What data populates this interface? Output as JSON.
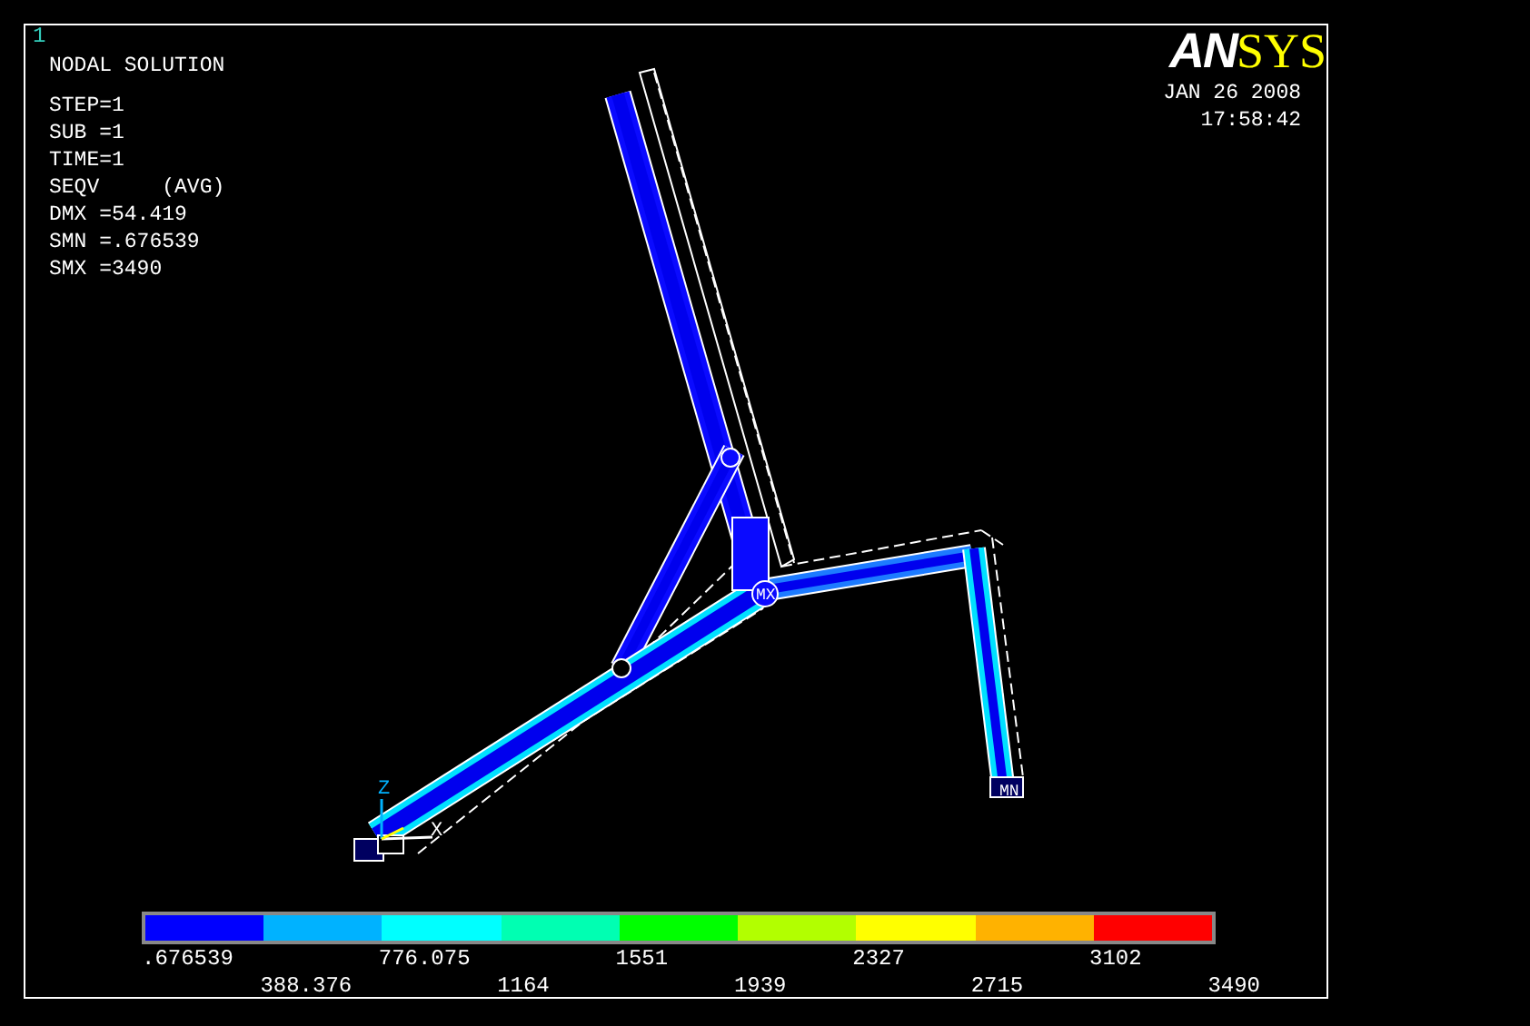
{
  "plot_number": "1",
  "title": "NODAL SOLUTION",
  "info_lines": [
    "STEP=1",
    "SUB =1",
    "TIME=1",
    "SEQV     (AVG)",
    "DMX =54.419",
    "SMN =.676539",
    "SMX =3490"
  ],
  "logo": {
    "part_1": "AN",
    "part_2": "SYS"
  },
  "date": "JAN 26 2008",
  "time": "17:58:42",
  "markers": [
    {
      "kind": "max",
      "label": "MX"
    },
    {
      "kind": "min",
      "label": "MN"
    }
  ],
  "axes": [
    {
      "kind": "z",
      "label": "Z"
    },
    {
      "kind": "x",
      "label": "X"
    }
  ],
  "legend": {
    "bands": [
      {
        "color": "#0000ff"
      },
      {
        "color": "#00b2ff"
      },
      {
        "color": "#00ffff"
      },
      {
        "color": "#00ffb2"
      },
      {
        "color": "#00ff00"
      },
      {
        "color": "#b2ff00"
      },
      {
        "color": "#ffff00"
      },
      {
        "color": "#ffb200"
      },
      {
        "color": "#ff0000"
      }
    ],
    "labels": [
      ".676539",
      "388.376",
      "776.075",
      "1164",
      "1551",
      "1939",
      "2327",
      "2715",
      "3102",
      "3490"
    ]
  }
}
